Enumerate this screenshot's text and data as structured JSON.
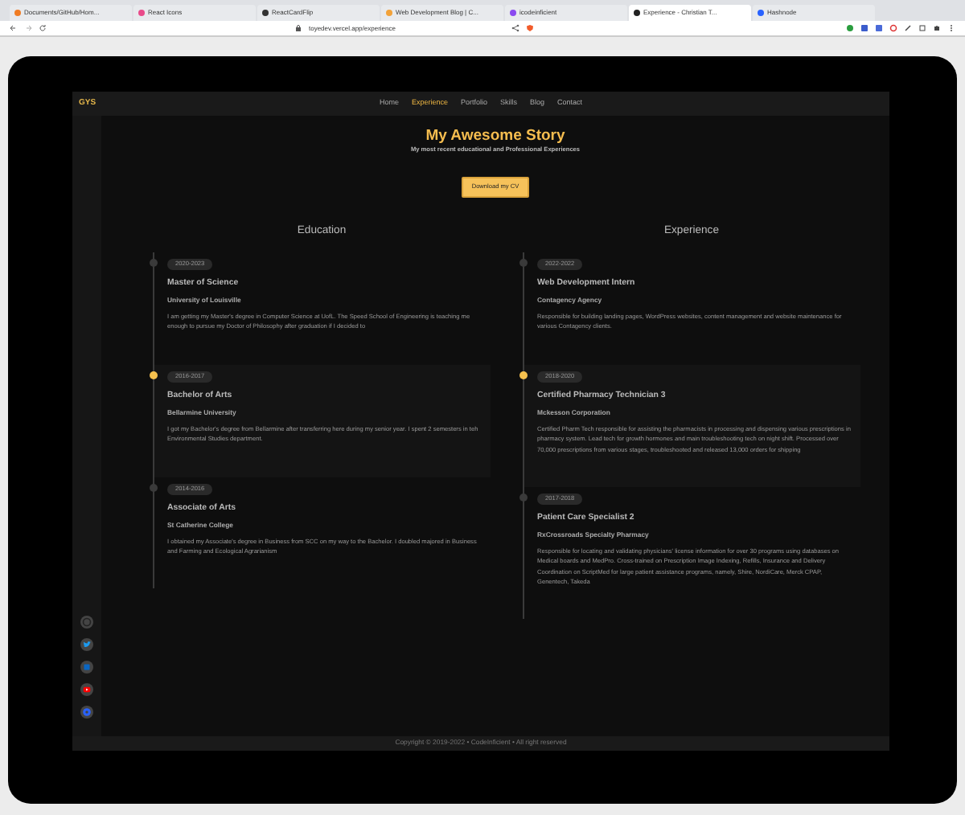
{
  "browser": {
    "tabs": [
      {
        "title": "Documents/GitHub/Hom...",
        "selected": false
      },
      {
        "title": "React Icons",
        "selected": false
      },
      {
        "title": "ReactCardFlip",
        "selected": false
      },
      {
        "title": "Web Development Blog | C...",
        "selected": false
      },
      {
        "title": "icodeinficient",
        "selected": false
      },
      {
        "title": "Experience - Christian T...",
        "selected": true
      },
      {
        "title": "Hashnode",
        "selected": false
      }
    ],
    "url": "toyedev.vercel.app/experience"
  },
  "site": {
    "logo": "GYS",
    "nav": [
      {
        "label": "Home",
        "selected": false
      },
      {
        "label": "Experience",
        "selected": true
      },
      {
        "label": "Portfolio",
        "selected": false
      },
      {
        "label": "Skills",
        "selected": false
      },
      {
        "label": "Blog",
        "selected": false
      },
      {
        "label": "Contact",
        "selected": false
      }
    ],
    "title": "My Awesome Story",
    "subtitle": "My most recent educational and Professional Experiences",
    "cv_button": "Download my CV",
    "sections": [
      {
        "heading": "Education",
        "entries": [
          {
            "dates": "2020-2023",
            "title": "Master of Science",
            "organization": "University of Louisville",
            "description": "I am getting my Master's degree in Computer Science at UofL. The Speed School of Engineering is teaching me enough to pursue my Doctor of Philosophy after graduation if I decided to",
            "active": false
          },
          {
            "dates": "2016-2017",
            "title": "Bachelor of Arts",
            "organization": "Bellarmine University",
            "description": "I got my Bachelor's degree from Bellarmine after transferring here during my senior year. I spent 2 semesters in teh Environmental Studies department.",
            "active": true
          },
          {
            "dates": "2014-2016",
            "title": "Associate of Arts",
            "organization": "St Catherine College",
            "description": "I obtained my Associate's degree in Business from SCC on my way to the Bachelor. I doubled majored in Business and Farming and Ecological Agrarianism",
            "active": false
          }
        ]
      },
      {
        "heading": "Experience",
        "entries": [
          {
            "dates": "2022-2022",
            "title": "Web Development Intern",
            "organization": "Contagency Agency",
            "description": "Responsible for building landing pages, WordPress websites, content management and website maintenance for various Contagency clients.",
            "active": false
          },
          {
            "dates": "2018-2020",
            "title": "Certified Pharmacy Technician 3",
            "organization": "Mckesson Corporation",
            "description": "Certified Pharm Tech responsible for assisting the pharmacists in processing and dispensing various prescriptions in pharmacy system. Lead tech for growth hormones and main troubleshooting tech on night shift. Processed over 70,000 prescriptions from various stages, troubleshooted and released 13,000 orders for shipping",
            "active": true
          },
          {
            "dates": "2017-2018",
            "title": "Patient Care Specialist 2",
            "organization": "RxCrossroads Specialty Pharmacy",
            "description": "Responsible for locating and validating physicians' license information for over 30 programs using databases on Medical boards and MedPro. Cross-trained on Prescription Image Indexing, Refills, Insurance and Delivery Coordination on ScriptMed for large patient assistance programs, namely, Shire, NordiCare, Merck CPAP, Genentech, Takeda",
            "active": false
          }
        ]
      }
    ],
    "footer": "Copyright © 2019-2022 • CodeInficient • All right reserved"
  }
}
